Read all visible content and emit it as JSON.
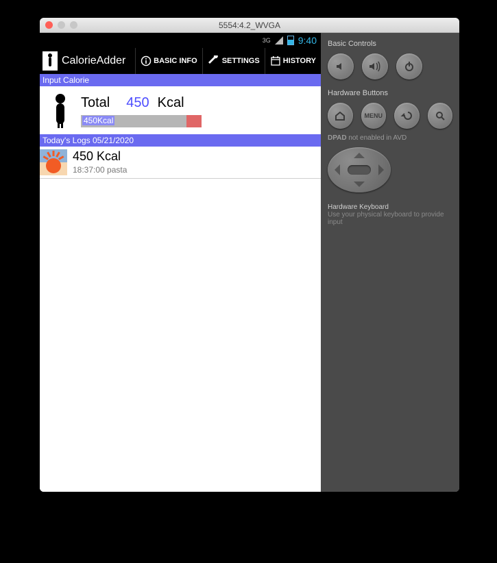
{
  "window": {
    "title": "5554:4.2_WVGA"
  },
  "statusBar": {
    "net": "3G",
    "clock": "9:40"
  },
  "actionBar": {
    "appTitle": "CalorieAdder",
    "basicInfo": "BASIC INFO",
    "settings": "SETTINGS",
    "history": "HISTORY"
  },
  "section": {
    "inputCalorie": "Input Calorie",
    "todaysLogs": "Today's Logs 05/21/2020"
  },
  "summary": {
    "totalLabel": "Total",
    "totalValue": "450",
    "unit": "Kcal",
    "progressText": "450Kcal"
  },
  "log": {
    "title": "450 Kcal",
    "meta": "18:37:00 pasta"
  },
  "panel": {
    "basicControls": "Basic Controls",
    "hardwareButtons": "Hardware Buttons",
    "dpadNote": "DPAD not enabled in AVD",
    "menuLabel": "MENU",
    "kbdTitle": "Hardware Keyboard",
    "kbdSub": "Use your physical keyboard to provide input"
  }
}
